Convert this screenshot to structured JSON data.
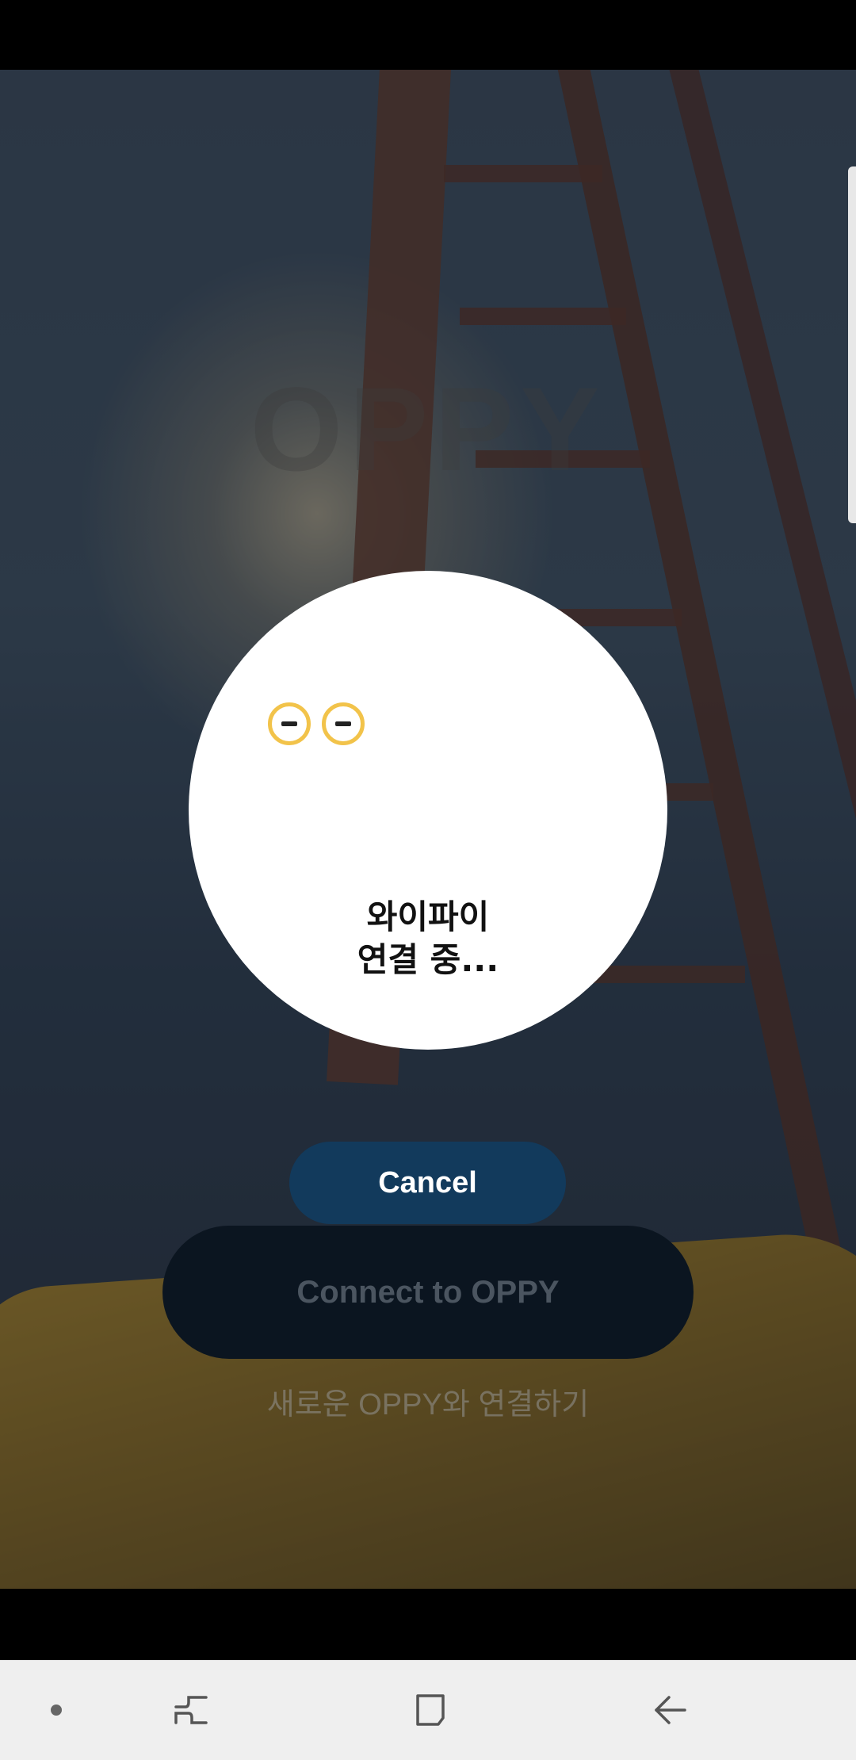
{
  "background": {
    "logo_text": "OPPY"
  },
  "main": {
    "connect_button_label": "Connect to OPPY",
    "new_connection_link": "새로운 OPPY와 연결하기"
  },
  "modal": {
    "status_line1": "와이파이",
    "status_line2": "연결 중...",
    "cancel_label": "Cancel",
    "eye_color": "#f2c34a"
  },
  "colors": {
    "cancel_button": "#123a5c",
    "connect_button": "#0b1520",
    "nav_bar": "#efefef"
  },
  "nav": {
    "icons": [
      "dot-icon",
      "recent-apps-icon",
      "home-icon",
      "back-icon"
    ]
  }
}
